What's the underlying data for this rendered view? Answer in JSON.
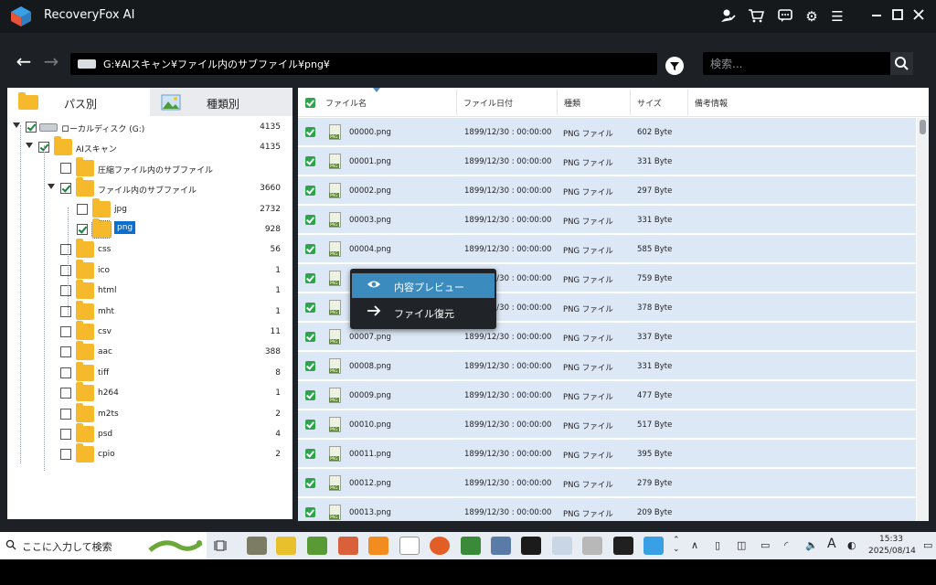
{
  "app": {
    "title": "RecoveryFox AI"
  },
  "navigation": {
    "path": "G:¥AIスキャン¥ファイル内のサブファイル¥png¥",
    "search_placeholder": "検索..."
  },
  "tabs": [
    {
      "label": "パス別",
      "active": true
    },
    {
      "label": "種類別",
      "active": false
    }
  ],
  "tree": [
    {
      "label": "ローカルディスク (G:)",
      "count": "4135",
      "checked": true,
      "level": 0,
      "expanded": true,
      "icon": "drive-icon"
    },
    {
      "label": "AIスキャン",
      "count": "4135",
      "checked": true,
      "level": 1,
      "expanded": true,
      "icon": "folder-icon"
    },
    {
      "label": "圧縮ファイル内のサブファイル",
      "count": "",
      "checked": false,
      "level": 2,
      "expanded": false,
      "icon": "folder-icon"
    },
    {
      "label": "ファイル内のサブファイル",
      "count": "3660",
      "checked": true,
      "level": 2,
      "expanded": true,
      "icon": "folder-icon"
    },
    {
      "label": "jpg",
      "count": "2732",
      "checked": false,
      "level": 3,
      "expanded": false,
      "icon": "folder-icon"
    },
    {
      "label": "png",
      "count": "928",
      "checked": true,
      "level": 3,
      "expanded": false,
      "icon": "folder-icon",
      "selected": true
    },
    {
      "label": "css",
      "count": "56",
      "checked": false,
      "level": 2,
      "expanded": false,
      "icon": "folder-icon"
    },
    {
      "label": "ico",
      "count": "1",
      "checked": false,
      "level": 2,
      "expanded": false,
      "icon": "folder-icon"
    },
    {
      "label": "html",
      "count": "1",
      "checked": false,
      "level": 2,
      "expanded": false,
      "icon": "folder-icon"
    },
    {
      "label": "mht",
      "count": "1",
      "checked": false,
      "level": 2,
      "expanded": false,
      "icon": "folder-icon"
    },
    {
      "label": "csv",
      "count": "11",
      "checked": false,
      "level": 2,
      "expanded": false,
      "icon": "folder-icon"
    },
    {
      "label": "aac",
      "count": "388",
      "checked": false,
      "level": 2,
      "expanded": false,
      "icon": "folder-icon"
    },
    {
      "label": "tiff",
      "count": "8",
      "checked": false,
      "level": 2,
      "expanded": false,
      "icon": "folder-icon"
    },
    {
      "label": "h264",
      "count": "1",
      "checked": false,
      "level": 2,
      "expanded": false,
      "icon": "folder-icon"
    },
    {
      "label": "m2ts",
      "count": "2",
      "checked": false,
      "level": 2,
      "expanded": false,
      "icon": "folder-icon"
    },
    {
      "label": "psd",
      "count": "4",
      "checked": false,
      "level": 2,
      "expanded": false,
      "icon": "folder-icon"
    },
    {
      "label": "cpio",
      "count": "2",
      "checked": false,
      "level": 2,
      "expanded": false,
      "icon": "folder-icon"
    }
  ],
  "table": {
    "columns": [
      "ファイル名",
      "ファイル日付",
      "種類",
      "サイズ",
      "備考情報"
    ],
    "rows": [
      {
        "name": "00000.png",
        "date": "1899/12/30 : 00:00:00",
        "type": "PNG ファイル",
        "size": "602 Byte"
      },
      {
        "name": "00001.png",
        "date": "1899/12/30 : 00:00:00",
        "type": "PNG ファイル",
        "size": "331 Byte"
      },
      {
        "name": "00002.png",
        "date": "1899/12/30 : 00:00:00",
        "type": "PNG ファイル",
        "size": "297 Byte"
      },
      {
        "name": "00003.png",
        "date": "1899/12/30 : 00:00:00",
        "type": "PNG ファイル",
        "size": "331 Byte"
      },
      {
        "name": "00004.png",
        "date": "1899/12/30 : 00:00:00",
        "type": "PNG ファイル",
        "size": "585 Byte"
      },
      {
        "name": "",
        "date": "1899/12/30 : 00:00:00",
        "type": "PNG ファイル",
        "size": "759 Byte"
      },
      {
        "name": "",
        "date": "1899/12/30 : 00:00:00",
        "type": "PNG ファイル",
        "size": "378 Byte"
      },
      {
        "name": "00007.png",
        "date": "1899/12/30 : 00:00:00",
        "type": "PNG ファイル",
        "size": "337 Byte"
      },
      {
        "name": "00008.png",
        "date": "1899/12/30 : 00:00:00",
        "type": "PNG ファイル",
        "size": "331 Byte"
      },
      {
        "name": "00009.png",
        "date": "1899/12/30 : 00:00:00",
        "type": "PNG ファイル",
        "size": "477 Byte"
      },
      {
        "name": "00010.png",
        "date": "1899/12/30 : 00:00:00",
        "type": "PNG ファイル",
        "size": "517 Byte"
      },
      {
        "name": "00011.png",
        "date": "1899/12/30 : 00:00:00",
        "type": "PNG ファイル",
        "size": "395 Byte"
      },
      {
        "name": "00012.png",
        "date": "1899/12/30 : 00:00:00",
        "type": "PNG ファイル",
        "size": "279 Byte"
      },
      {
        "name": "00013.png",
        "date": "1899/12/30 : 00:00:00",
        "type": "PNG ファイル",
        "size": "209 Byte"
      }
    ]
  },
  "context_menu": [
    {
      "label": "内容プレビュー",
      "icon": "eye-icon"
    },
    {
      "label": "ファイル復元",
      "icon": "arrow-right-icon"
    }
  ],
  "taskbar": {
    "search_text": "ここに入力して検索",
    "time": "15:33",
    "date": "2025/08/14",
    "ime": "A"
  },
  "colors": {
    "accent": "#3c8bbf",
    "row_bg": "#dce8f6",
    "check_green": "#2da54a",
    "folder": "#f6b92c",
    "selection": "#0b6fd1"
  }
}
